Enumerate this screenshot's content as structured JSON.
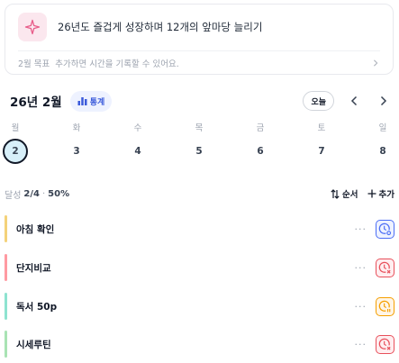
{
  "goal": {
    "icon": "sparkle-icon",
    "title": "26년도 즐겁게 성장하며 12개의 앞마당 늘리기",
    "month_label": "2월 목표",
    "hint": "추가하면 시간을 기록할 수 있어요."
  },
  "calendar": {
    "month_label": "26년 2월",
    "stats_label": "통계",
    "today_label": "오늘",
    "weekdays": [
      "월",
      "화",
      "수",
      "목",
      "금",
      "토",
      "일"
    ],
    "dates": [
      "2",
      "3",
      "4",
      "5",
      "6",
      "7",
      "8"
    ],
    "selected_index": 0
  },
  "progress": {
    "label": "달성",
    "count": "2/4",
    "separator": "·",
    "percent": "50%",
    "sort_label": "순서",
    "add_label": "추가"
  },
  "tasks": [
    {
      "title": "아침 확인",
      "bar_color": "#f4d27a",
      "status": "in-progress",
      "status_color": "#4c6ef5",
      "status_bg": "#eef2ff"
    },
    {
      "title": "단지비교",
      "bar_color": "#ff9aa2",
      "status": "failed",
      "status_color": "#e8505b",
      "status_bg": "#ffeef0"
    },
    {
      "title": "독서 50p",
      "bar_color": "#8ee3d0",
      "status": "paused",
      "status_color": "#f59f00",
      "status_bg": "#fff5e6"
    },
    {
      "title": "시세루틴",
      "bar_color": "#a9e3b4",
      "status": "failed",
      "status_color": "#e8505b",
      "status_bg": "#ffeef0"
    }
  ],
  "colors": {
    "accent": "#3b5bdb",
    "selected_date_bg": "#d7eff9",
    "goal_icon_bg": "#fbe7ee",
    "goal_icon_color": "#e85d8a"
  }
}
